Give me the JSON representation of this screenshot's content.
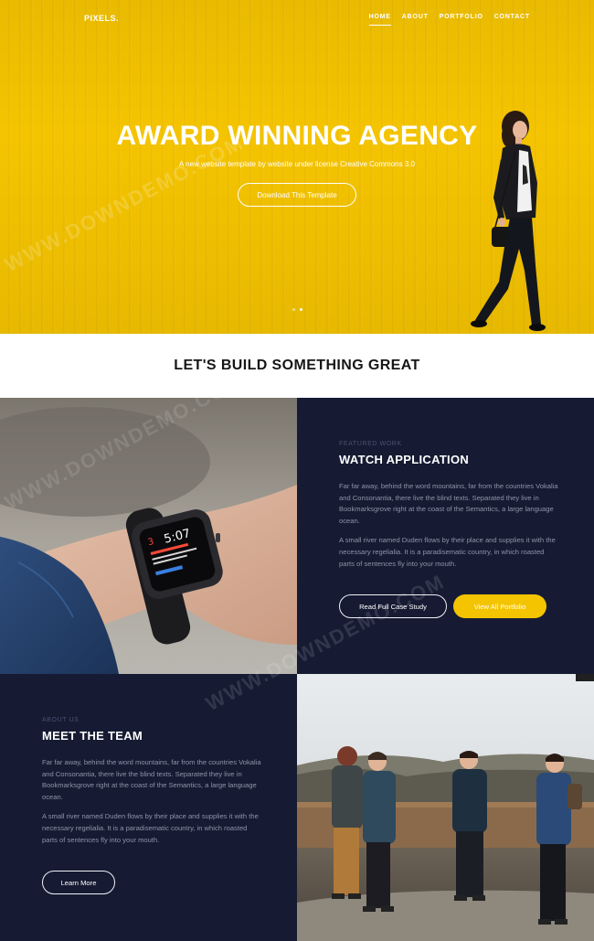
{
  "nav": {
    "logo": "PIXELS.",
    "items": [
      {
        "label": "HOME",
        "active": true
      },
      {
        "label": "ABOUT",
        "active": false
      },
      {
        "label": "PORTFOLIO",
        "active": false
      },
      {
        "label": "CONTACT",
        "active": false
      }
    ]
  },
  "hero": {
    "title": "AWARD WINNING AGENCY",
    "subtitle": "A new website template by website under license Creative Commons 3.0",
    "button_label": "Download This Template",
    "slides_total": 2,
    "slide_active": 2,
    "background_color": "#f5c400"
  },
  "build": {
    "title": "LET'S BUILD SOMETHING GREAT"
  },
  "featured": {
    "eyebrow": "FEATURED WORK",
    "title": "WATCH APPLICATION",
    "paragraph_1": "Far far away, behind the word mountains, far from the countries Vokalia and Consonantia, there live the blind texts. Separated they live in Bookmarksgrove right at the coast of the Semantics, a large language ocean.",
    "paragraph_2": "A small river named Duden flows by their place and supplies it with the necessary regelialia. It is a paradisematic country, in which roasted parts of sentences fly into your mouth.",
    "button_primary": "Read Full Case Study",
    "button_secondary": "View All Portfolio",
    "watch_time": "5:07",
    "watch_date": "3"
  },
  "team": {
    "eyebrow": "ABOUT US",
    "title": "MEET THE TEAM",
    "paragraph_1": "Far far away, behind the word mountains, far from the countries Vokalia and Consonantia, there live the blind texts. Separated they live in Bookmarksgrove right at the coast of the Semantics, a large language ocean.",
    "paragraph_2": "A small river named Duden flows by their place and supplies it with the necessary regelialia. It is a paradisematic country, in which roasted parts of sentences fly into your mouth.",
    "button_label": "Learn More"
  },
  "colors": {
    "accent": "#f5c400",
    "dark_panel": "#161b33",
    "body_text": "#8e93a8"
  },
  "watermark": "WWW.DOWNDEMO.COM"
}
